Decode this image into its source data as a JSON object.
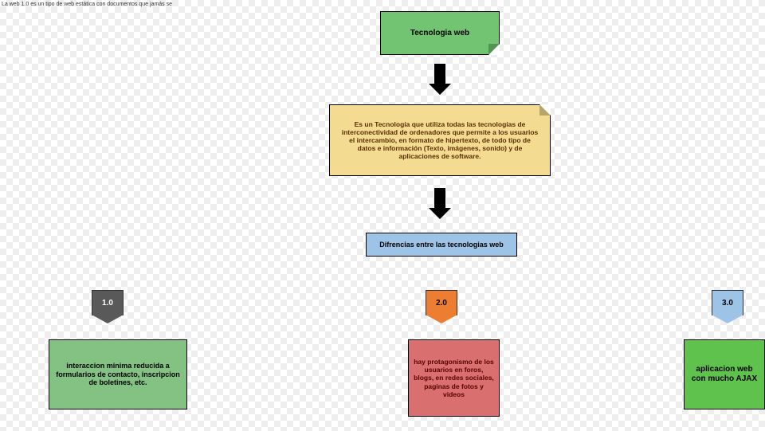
{
  "corner_note": "La web 1.0 es un tipo de\nweb estática con\ndocumentos que jamás se",
  "title_box": "Tecnologia web",
  "definition": "Es un Tecnología que utiliza todas las tecnologías de interconectividad de ordenadores que permite a los usuarios el intercambio, en formato de hipertexto, de todo tipo de datos e información (Texto, imágenes, sonido) y de aplicaciones de software.",
  "diff_title": "Difrencias  entre las tecnologias web",
  "badges": {
    "v1": "1.0",
    "v2": "2.0",
    "v3": "3.0"
  },
  "card1": "interaccion minima reducida a formularios de contacto, inscripcion de boletines, etc.",
  "card2": "hay protagonismo de los usuarios en foros, blogs, en redes sociales, paginas de fotos y videos",
  "card3": "aplicacion web con mucho AJAX"
}
